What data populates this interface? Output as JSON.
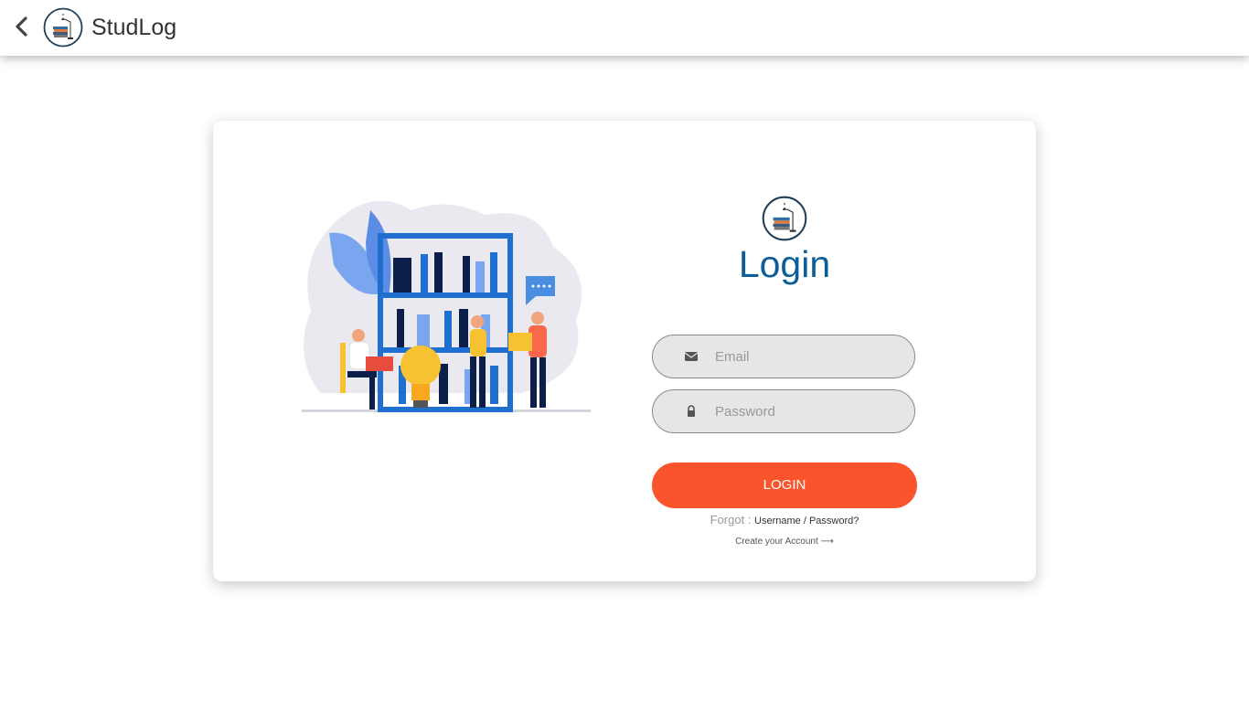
{
  "header": {
    "app_name": "StudLog",
    "back_icon": "chevron-left-icon",
    "logo_icon": "book-lamp-logo-icon"
  },
  "login": {
    "title": "Login",
    "email_placeholder": "Email",
    "password_placeholder": "Password",
    "email_icon": "envelope-icon",
    "password_icon": "lock-icon",
    "button_label": "LOGIN",
    "forgot_prefix": "Forgot :",
    "forgot_link": "Username / Password?",
    "create_account": "Create your Account ⟶"
  },
  "colors": {
    "accent": "#f9542c",
    "title": "#0b5e96",
    "field_bg": "#e6e6e6"
  }
}
